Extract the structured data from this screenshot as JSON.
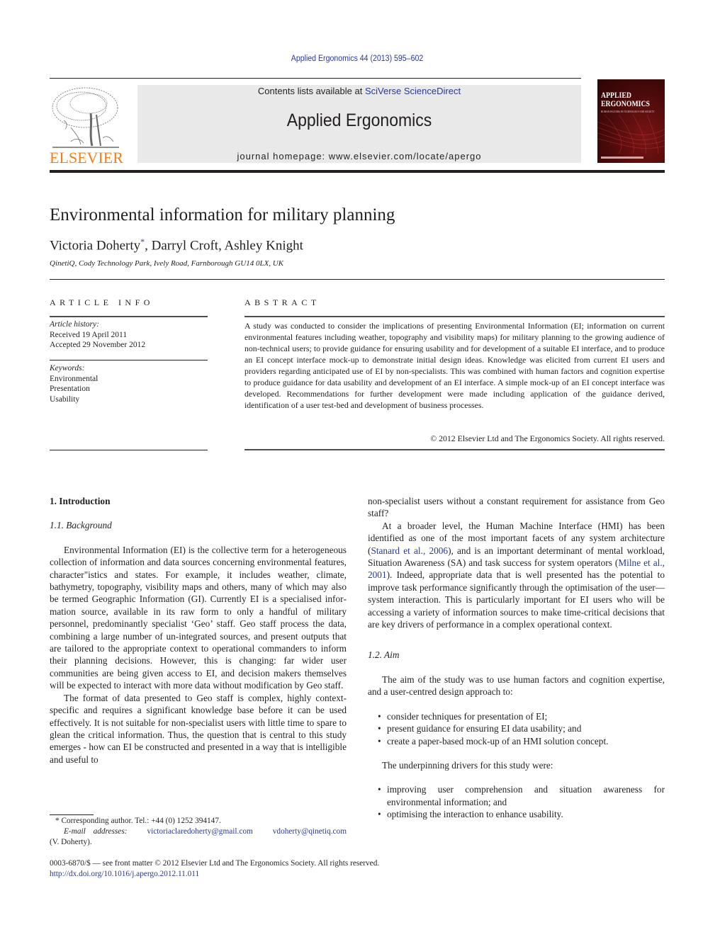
{
  "header": {
    "journal_ref": "Applied Ergonomics 44 (2013) 595–602",
    "publisher_logo_text": "ELSEVIER",
    "contents_prefix": "Contents lists available at ",
    "contents_link": "SciVerse ScienceDirect",
    "journal_title": "Applied Ergonomics",
    "homepage": "journal homepage: www.elsevier.com/locate/apergo",
    "cover": {
      "title_line1": "APPLIED",
      "title_line2": "ERGONOMICS",
      "subtitle": "HUMAN FACTORS IN TECHNOLOGY AND SOCIETY"
    }
  },
  "article": {
    "title": "Environmental information for military planning",
    "authors": [
      {
        "name": "Victoria Doherty",
        "mark": "*"
      },
      {
        "name": "Darryl Croft"
      },
      {
        "name": "Ashley Knight"
      }
    ],
    "affiliation": "QinetiQ, Cody Technology Park, Ively Road, Farnborough GU14 0LX, UK"
  },
  "article_info": {
    "heading": "ARTICLE INFO",
    "history_label": "Article history:",
    "received": "Received 19 April 2011",
    "accepted": "Accepted 29 November 2012",
    "keywords_label": "Keywords:",
    "keywords": [
      "Environmental",
      "Presentation",
      "Usability"
    ]
  },
  "abstract": {
    "heading": "ABSTRACT",
    "text": "A study was conducted to consider the implications of presenting Environmental Information (EI; information on current environmental features including weather, topography and visibility maps) for military planning to the growing audience of non-technical users; to provide guidance for ensuring usability and for development of a suitable EI interface, and to produce an EI concept interface mock-up to demonstrate initial design ideas. Knowledge was elicited from current EI users and providers regarding anticipated use of EI by non-specialists. This was combined with human factors and cognition expertise to produce guidance for data usability and development of an EI interface. A simple mock-up of an EI concept interface was developed. Recommendations for further development were made including application of the guidance derived, identification of a user test-bed and development of business processes.",
    "copyright": "© 2012 Elsevier Ltd and The Ergonomics Society. All rights reserved."
  },
  "body": {
    "section1": "1.  Introduction",
    "section1_1": "1.1.  Background",
    "p1": "Environmental Information (EI) is the collective term for a heterogeneous collection of information and data sources con­cerning environmental features, character\"istics and states. For example, it includes weather, climate, bathymetry, topography, visibility maps and others, many of which may also be termed Geographic Information (GI). Currently EI is a specialised infor­mation source, available in its raw form to only a handful of military personnel, predominantly specialist ‘Geo’ staff. Geo staff process the data, combining a large number of un-integrated sources, and present outputs that are tailored to the appropriate context to operational commanders to inform their planning decisions. However, this is changing: far wider user communities are being given access to EI, and decision makers themselves will be expected to interact with more data without modification by Geo staff.",
    "p2": "The format of data presented to Geo staff is complex, highly context-specific and requires a significant knowledge base before it can be used effectively. It is not suitable for non-specialist users with little time to spare to glean the critical information. Thus, the question that is central to this study emerges - how can EI be constructed and presented in a way that is intelligible and useful to",
    "p2_cont": "non-specialist users without a constant requirement for assistance from Geo staff?",
    "p3_a": "At a broader level, the Human Machine Interface (HMI) has been identified as one of the most important facets of any system architecture (",
    "p3_ref1": "Stanard et al., 2006",
    "p3_b": "), and is an important determinant of mental workload, Situation Awareness (SA) and task success for system operators (",
    "p3_ref2": "Milne et al., 2001",
    "p3_c": "). Indeed, appropriate data that is well presented has the potential to improve task performance significantly through the optimisation of the user—system inter­action. This is particularly important for EI users who will be accessing a variety of information sources to make time-critical decisions that are key drivers of performance in a complex opera­tional context.",
    "section1_2": "1.2.  Aim",
    "aim_intro": "The aim of the study was to use human factors and cognition expertise, and a user-centred design approach to:",
    "aim_bullets": [
      "consider techniques for presentation of EI;",
      "present guidance for ensuring EI data usability; and",
      "create a paper-based mock-up of an HMI solution concept."
    ],
    "drivers_intro": "The underpinning drivers for this study were:",
    "driver_bullets": [
      "improving user comprehension and situation awareness for environmental information; and",
      "optimising the interaction to enhance usability."
    ]
  },
  "footnote": {
    "mark": "*",
    "corresponding": " Corresponding author. Tel.: +44 (0) 1252 394147.",
    "email_label": "E-mail addresses:",
    "email1": "victoriaclaredoherty@gmail.com",
    "email2": "vdoherty@qinetiq.com",
    "email_owner": "(V. Doherty)."
  },
  "bottom": {
    "issn_line": "0003-6870/$ — see front matter © 2012 Elsevier Ltd and The Ergonomics Society. All rights reserved.",
    "doi": "http://dx.doi.org/10.1016/j.apergo.2012.11.011"
  },
  "colors": {
    "link": "#2b3a8c",
    "elsevier_orange": "#f07f1a",
    "banner_gray": "#e9e9ea",
    "cover_red": "#7a1414"
  }
}
